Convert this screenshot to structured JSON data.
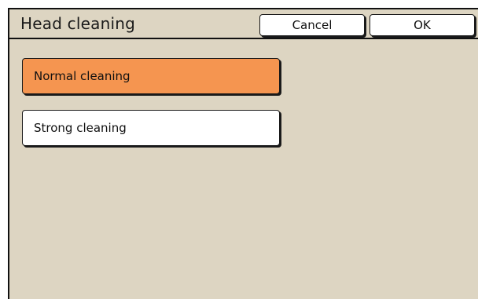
{
  "dialog": {
    "title": "Head cleaning",
    "cancel_label": "Cancel",
    "ok_label": "OK"
  },
  "options": [
    {
      "label": "Normal cleaning",
      "selected": true
    },
    {
      "label": "Strong cleaning",
      "selected": false
    }
  ],
  "colors": {
    "background": "#ddd5c2",
    "selected": "#f59550",
    "button": "#ffffff",
    "border": "#111111"
  }
}
